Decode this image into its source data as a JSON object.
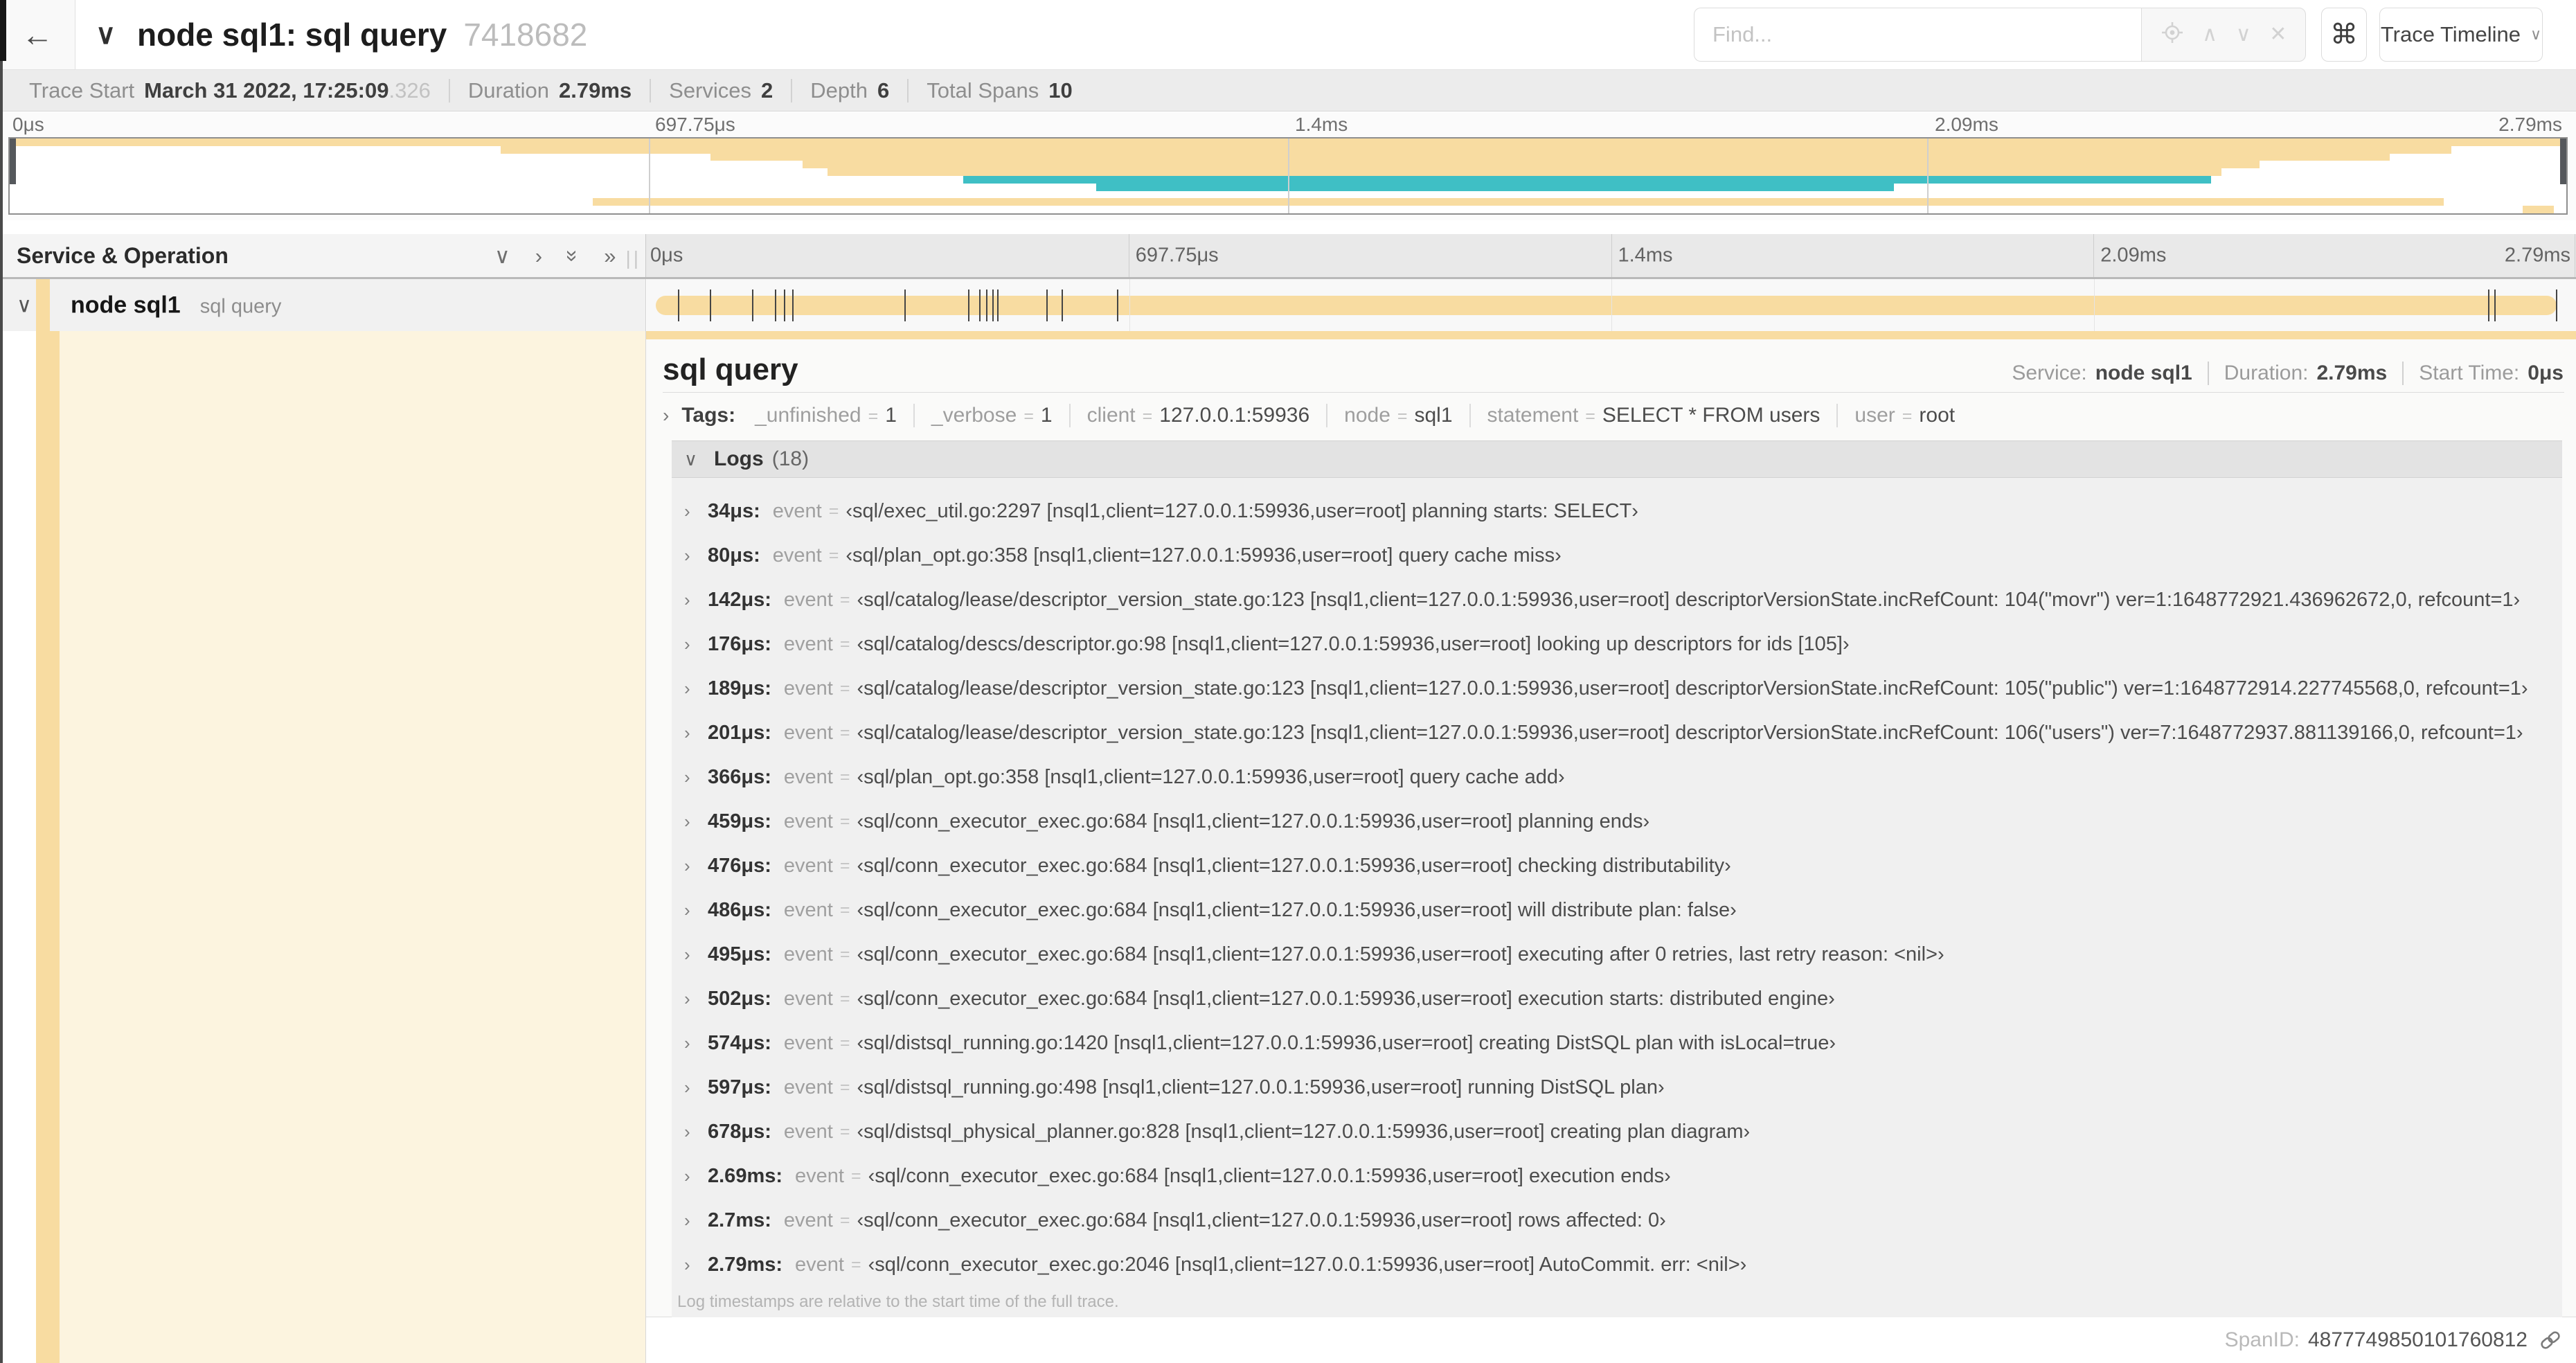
{
  "header": {
    "back_icon": "←",
    "collapse_icon": "∨",
    "title": "node sql1: sql query",
    "trace_id": "7418682",
    "find_placeholder": "Find...",
    "prev_icon": "∧",
    "next_icon": "∨",
    "clear_icon": "✕",
    "shortcut_icon": "⌘",
    "view_label": "Trace Timeline",
    "view_chevron": "∨"
  },
  "trace_meta": {
    "items": [
      {
        "label": "Trace Start",
        "value": "March 31 2022, 17:25:09",
        "extra": ".326"
      },
      {
        "label": "Duration",
        "value": "2.79ms",
        "extra": ""
      },
      {
        "label": "Services",
        "value": "2",
        "extra": ""
      },
      {
        "label": "Depth",
        "value": "6",
        "extra": ""
      },
      {
        "label": "Total Spans",
        "value": "10",
        "extra": ""
      }
    ]
  },
  "minimap": {
    "labels": [
      {
        "text": "0μs",
        "pos": 0
      },
      {
        "text": "697.75μs",
        "pos": 25
      },
      {
        "text": "1.4ms",
        "pos": 50
      },
      {
        "text": "2.09ms",
        "pos": 75
      },
      {
        "text": "2.79ms",
        "pos": 100
      }
    ],
    "grid_positions": [
      25,
      50,
      75
    ],
    "colors": {
      "tan": "#F8DCA1",
      "teal": "#3FBFC5"
    },
    "spans": [
      {
        "row": 0,
        "start": 0,
        "end": 100,
        "color": "tan"
      },
      {
        "row": 1,
        "start": 19.2,
        "end": 95.5,
        "color": "tan"
      },
      {
        "row": 2,
        "start": 27.4,
        "end": 93.1,
        "color": "tan"
      },
      {
        "row": 3,
        "start": 31,
        "end": 88,
        "color": "tan"
      },
      {
        "row": 4,
        "start": 32,
        "end": 86.5,
        "color": "tan"
      },
      {
        "row": 5,
        "start": 37.3,
        "end": 86.1,
        "color": "teal"
      },
      {
        "row": 6,
        "start": 42.5,
        "end": 73.7,
        "color": "teal"
      },
      {
        "row": 8,
        "start": 22.8,
        "end": 95.2,
        "color": "tan"
      },
      {
        "row": 9,
        "start": 98.3,
        "end": 99.5,
        "color": "tan"
      }
    ]
  },
  "timeline": {
    "col_header": "Service & Operation",
    "collapse_one_icon": "∨",
    "expand_one_icon": "›",
    "collapse_all_icon": "»",
    "expand_all_icon": "»",
    "grip_icon": "||",
    "ticks": [
      {
        "text": "0μs",
        "pos": 0
      },
      {
        "text": "697.75μs",
        "pos": 25
      },
      {
        "text": "1.4ms",
        "pos": 50
      },
      {
        "text": "2.09ms",
        "pos": 75
      },
      {
        "text": "2.79ms",
        "pos": 100
      }
    ],
    "row": {
      "chevron": "∨",
      "service": "node sql1",
      "operation": "sql query"
    }
  },
  "detail": {
    "title": "sql query",
    "meta": [
      {
        "label": "Service:",
        "value": "node sql1"
      },
      {
        "label": "Duration:",
        "value": "2.79ms"
      },
      {
        "label": "Start Time:",
        "value": "0μs"
      }
    ],
    "tags_chevron": "›",
    "tags_label": "Tags:",
    "tags": [
      {
        "key": "_unfinished",
        "value": "1"
      },
      {
        "key": "_verbose",
        "value": "1"
      },
      {
        "key": "client",
        "value": "127.0.0.1:59936"
      },
      {
        "key": "node",
        "value": "sql1"
      },
      {
        "key": "statement",
        "value": "SELECT * FROM users"
      },
      {
        "key": "user",
        "value": "root"
      }
    ],
    "logs_chevron": "∨",
    "logs_label": "Logs",
    "logs_count": "(18)",
    "total_us": 2790,
    "logs": [
      {
        "t": "34μs:",
        "us": 34,
        "key": "event",
        "value": "‹sql/exec_util.go:2297 [nsql1,client=127.0.0.1:59936,user=root] planning starts: SELECT›"
      },
      {
        "t": "80μs:",
        "us": 80,
        "key": "event",
        "value": "‹sql/plan_opt.go:358 [nsql1,client=127.0.0.1:59936,user=root] query cache miss›"
      },
      {
        "t": "142μs:",
        "us": 142,
        "key": "event",
        "value": "‹sql/catalog/lease/descriptor_version_state.go:123 [nsql1,client=127.0.0.1:59936,user=root] descriptorVersionState.incRefCount: 104(\"movr\") ver=1:1648772921.436962672,0, refcount=1›"
      },
      {
        "t": "176μs:",
        "us": 176,
        "key": "event",
        "value": "‹sql/catalog/descs/descriptor.go:98 [nsql1,client=127.0.0.1:59936,user=root] looking up descriptors for ids [105]›"
      },
      {
        "t": "189μs:",
        "us": 189,
        "key": "event",
        "value": "‹sql/catalog/lease/descriptor_version_state.go:123 [nsql1,client=127.0.0.1:59936,user=root] descriptorVersionState.incRefCount: 105(\"public\") ver=1:1648772914.227745568,0, refcount=1›"
      },
      {
        "t": "201μs:",
        "us": 201,
        "key": "event",
        "value": "‹sql/catalog/lease/descriptor_version_state.go:123 [nsql1,client=127.0.0.1:59936,user=root] descriptorVersionState.incRefCount: 106(\"users\") ver=7:1648772937.881139166,0, refcount=1›"
      },
      {
        "t": "366μs:",
        "us": 366,
        "key": "event",
        "value": "‹sql/plan_opt.go:358 [nsql1,client=127.0.0.1:59936,user=root] query cache add›"
      },
      {
        "t": "459μs:",
        "us": 459,
        "key": "event",
        "value": "‹sql/conn_executor_exec.go:684 [nsql1,client=127.0.0.1:59936,user=root] planning ends›"
      },
      {
        "t": "476μs:",
        "us": 476,
        "key": "event",
        "value": "‹sql/conn_executor_exec.go:684 [nsql1,client=127.0.0.1:59936,user=root] checking distributability›"
      },
      {
        "t": "486μs:",
        "us": 486,
        "key": "event",
        "value": "‹sql/conn_executor_exec.go:684 [nsql1,client=127.0.0.1:59936,user=root] will distribute plan: false›"
      },
      {
        "t": "495μs:",
        "us": 495,
        "key": "event",
        "value": "‹sql/conn_executor_exec.go:684 [nsql1,client=127.0.0.1:59936,user=root] executing after 0 retries, last retry reason: <nil>›"
      },
      {
        "t": "502μs:",
        "us": 502,
        "key": "event",
        "value": "‹sql/conn_executor_exec.go:684 [nsql1,client=127.0.0.1:59936,user=root] execution starts: distributed engine›"
      },
      {
        "t": "574μs:",
        "us": 574,
        "key": "event",
        "value": "‹sql/distsql_running.go:1420 [nsql1,client=127.0.0.1:59936,user=root] creating DistSQL plan with isLocal=true›"
      },
      {
        "t": "597μs:",
        "us": 597,
        "key": "event",
        "value": "‹sql/distsql_running.go:498 [nsql1,client=127.0.0.1:59936,user=root] running DistSQL plan›"
      },
      {
        "t": "678μs:",
        "us": 678,
        "key": "event",
        "value": "‹sql/distsql_physical_planner.go:828 [nsql1,client=127.0.0.1:59936,user=root] creating plan diagram›"
      },
      {
        "t": "2.69ms:",
        "us": 2690,
        "key": "event",
        "value": "‹sql/conn_executor_exec.go:684 [nsql1,client=127.0.0.1:59936,user=root] execution ends›"
      },
      {
        "t": "2.7ms:",
        "us": 2700,
        "key": "event",
        "value": "‹sql/conn_executor_exec.go:684 [nsql1,client=127.0.0.1:59936,user=root] rows affected: 0›"
      },
      {
        "t": "2.79ms:",
        "us": 2790,
        "key": "event",
        "value": "‹sql/conn_executor_exec.go:2046 [nsql1,client=127.0.0.1:59936,user=root] AutoCommit. err: <nil>›"
      }
    ],
    "footer": "Log timestamps are relative to the start time of the full trace.",
    "span_id_label": "SpanID:",
    "span_id": "4877749850101760812"
  }
}
